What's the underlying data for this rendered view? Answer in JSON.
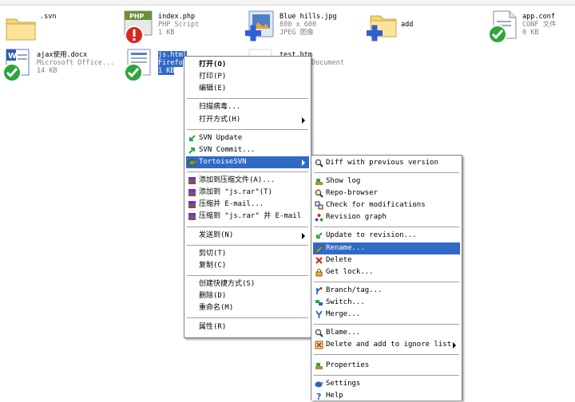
{
  "files": [
    {
      "name": ".svn",
      "line2": "",
      "line3": "",
      "icon": "folder-icon"
    },
    {
      "name": "index.php",
      "line2": "PHP Script",
      "line3": "1 KB",
      "icon": "php-conflict-icon"
    },
    {
      "name": "Blue hills.jpg",
      "line2": "800 x 600",
      "line3": "JPEG 图像",
      "icon": "image-added-icon"
    },
    {
      "name": "add",
      "line2": "",
      "line3": "",
      "icon": "folder-added-icon"
    },
    {
      "name": "app.conf",
      "line2": "CONF 文件",
      "line3": "0 KB",
      "icon": "file-normal-icon"
    },
    {
      "name": "ajax使用.docx",
      "line2": "Microsoft Office...",
      "line3": "14 KB",
      "icon": "word-normal-icon"
    },
    {
      "name": "js.html",
      "line2": "Firefo",
      "line3": "1 KB",
      "icon": "html-normal-icon"
    },
    {
      "name": "test.htm",
      "line2": "Document",
      "line3": "",
      "icon": "html-icon"
    }
  ],
  "context_menu": {
    "open": "打开(O)",
    "print": "打印(P)",
    "edit": "编辑(E)",
    "scan": "扫描病毒...",
    "open_with": "打开方式(H)",
    "svn_update": "SVN Update",
    "svn_commit": "SVN Commit...",
    "tortoise": "TortoiseSVN",
    "add_archive": "添加到压缩文件(A)...",
    "add_jsrar": "添加到 \"js.rar\"(T)",
    "compress_email": "压缩并 E-mail...",
    "compress_jsrar_email": "压缩到 \"js.rar\" 并 E-mail",
    "send_to": "发送到(N)",
    "cut": "剪切(T)",
    "copy": "复制(C)",
    "create_shortcut": "创建快捷方式(S)",
    "delete": "删除(D)",
    "rename": "重命名(M)",
    "properties": "属性(R)"
  },
  "svn_menu": {
    "diff": "Diff with previous version",
    "show_log": "Show log",
    "repo_browser": "Repo-browser",
    "check_mods": "Check for modifications",
    "rev_graph": "Revision graph",
    "update_rev": "Update to revision...",
    "rename": "Rename...",
    "delete": "Delete",
    "get_lock": "Get lock...",
    "branch_tag": "Branch/tag...",
    "switch": "Switch...",
    "merge": "Merge...",
    "blame": "Blame...",
    "delete_ignore": "Delete and add to ignore list",
    "properties": "Properties",
    "settings": "Settings",
    "help": "Help"
  },
  "colors": {
    "highlight": "#316ac5",
    "check_green": "#2ea63c",
    "conflict_red": "#d7261e",
    "added_blue": "#2f5fd0"
  }
}
